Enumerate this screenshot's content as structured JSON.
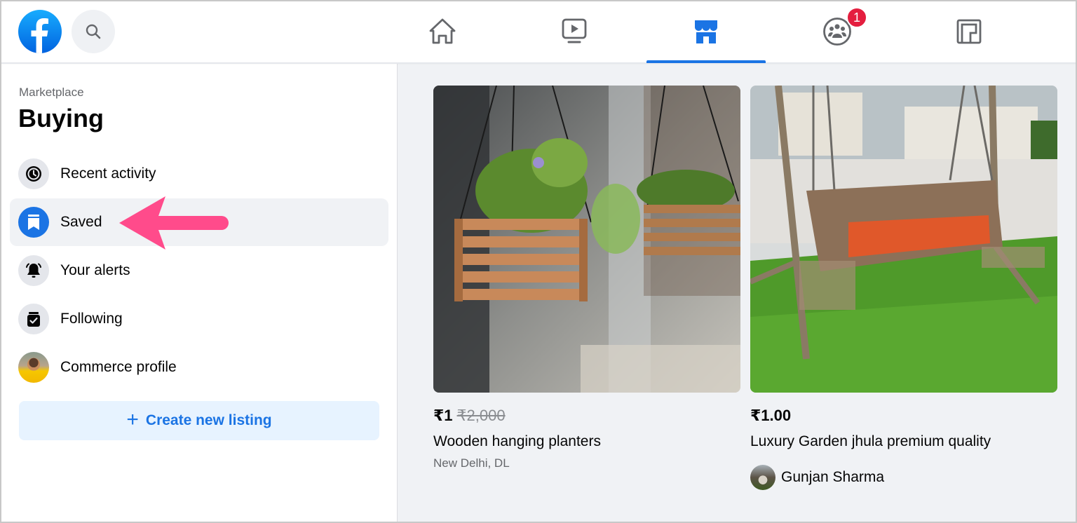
{
  "topbar": {
    "logo": "facebook-logo",
    "search_icon": "search-icon",
    "tabs": [
      {
        "name": "home",
        "icon": "home-icon",
        "active": false
      },
      {
        "name": "watch",
        "icon": "video-icon",
        "active": false
      },
      {
        "name": "marketplace",
        "icon": "marketplace-store-icon",
        "active": true
      },
      {
        "name": "groups",
        "icon": "groups-icon",
        "active": false,
        "badge": "1"
      },
      {
        "name": "gaming",
        "icon": "gaming-icon",
        "active": false
      }
    ],
    "accent_color": "#1b74e4",
    "badge_color": "#e41e3f"
  },
  "sidebar": {
    "breadcrumb": "Marketplace",
    "title": "Buying",
    "items": [
      {
        "label": "Recent activity",
        "icon": "clock-icon",
        "selected": false
      },
      {
        "label": "Saved",
        "icon": "bookmark-icon",
        "selected": true
      },
      {
        "label": "Your alerts",
        "icon": "bell-icon",
        "selected": false
      },
      {
        "label": "Following",
        "icon": "following-box-check-icon",
        "selected": false
      },
      {
        "label": "Commerce profile",
        "icon": "profile-avatar",
        "selected": false
      }
    ],
    "create_button": {
      "icon": "+",
      "label": "Create new listing"
    }
  },
  "annotation": {
    "type": "arrow",
    "color": "#ff4b8b",
    "points_to": "Saved"
  },
  "listings": [
    {
      "image": "wooden-hanging-planters-photo",
      "price": "₹1",
      "original_price": "₹2,000",
      "title": "Wooden hanging planters",
      "location": "New Delhi, DL"
    },
    {
      "image": "garden-swing-photo",
      "price": "₹1.00",
      "title": "Luxury Garden jhula premium quality",
      "seller": "Gunjan Sharma"
    }
  ]
}
